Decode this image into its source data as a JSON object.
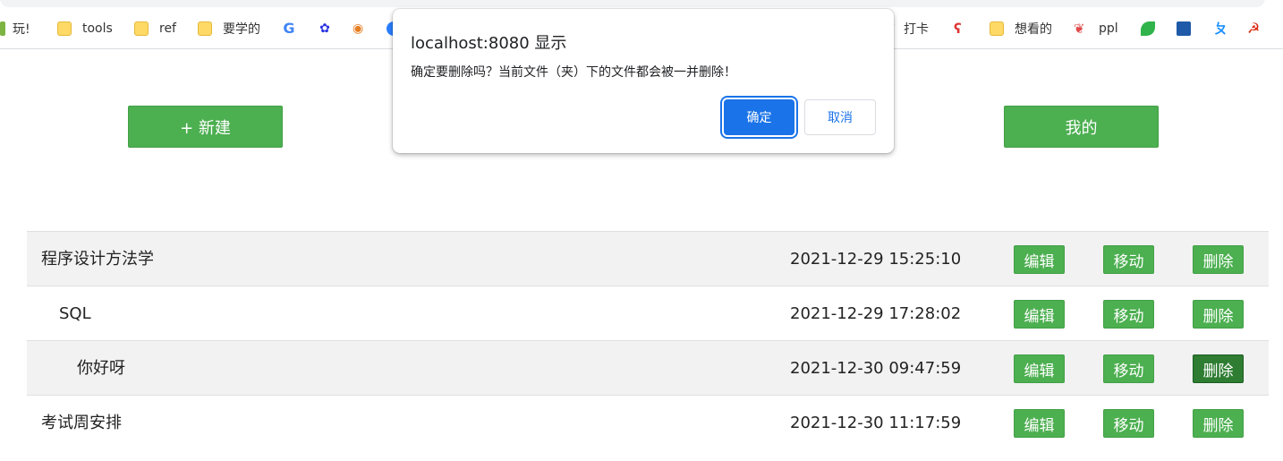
{
  "bookmarks": [
    {
      "label": "玩!",
      "icon": "partial-icon"
    },
    {
      "label": "tools",
      "icon": "folder-icon"
    },
    {
      "label": "ref",
      "icon": "folder-icon"
    },
    {
      "label": "要学的",
      "icon": "folder-icon"
    },
    {
      "label": "",
      "icon": "google-icon"
    },
    {
      "label": "",
      "icon": "baidu-icon"
    },
    {
      "label": "",
      "icon": "orange-circle-icon"
    },
    {
      "label": "打卡",
      "icon": "check-icon"
    },
    {
      "label": "",
      "icon": "swirl-icon"
    },
    {
      "label": "想看的",
      "icon": "folder-icon"
    },
    {
      "label": "ppl",
      "icon": "bird-icon"
    },
    {
      "label": "",
      "icon": "leaf-icon"
    },
    {
      "label": "",
      "icon": "monitor-icon"
    },
    {
      "label": "",
      "icon": "k-icon"
    },
    {
      "label": "",
      "icon": "star-icon"
    }
  ],
  "toolbar": {
    "new_label": "+ 新建",
    "mine_label": "我的"
  },
  "dialog": {
    "title": "localhost:8080 显示",
    "message": "确定要删除吗？当前文件（夹）下的文件都会被一并删除！",
    "ok_label": "确定",
    "cancel_label": "取消"
  },
  "rows": [
    {
      "name": "程序设计方法学",
      "time": "2021-12-29 15:25:10",
      "edit": "编辑",
      "move": "移动",
      "delete": "删除"
    },
    {
      "name": "SQL",
      "time": "2021-12-29 17:28:02",
      "edit": "编辑",
      "move": "移动",
      "delete": "删除"
    },
    {
      "name": "你好呀",
      "time": "2021-12-30 09:47:59",
      "edit": "编辑",
      "move": "移动",
      "delete": "删除"
    },
    {
      "name": "考试周安排",
      "time": "2021-12-30 11:17:59",
      "edit": "编辑",
      "move": "移动",
      "delete": "删除"
    }
  ],
  "colors": {
    "accent_green": "#4caf50",
    "active_green": "#2e7d32",
    "dialog_blue": "#1a73e8"
  }
}
